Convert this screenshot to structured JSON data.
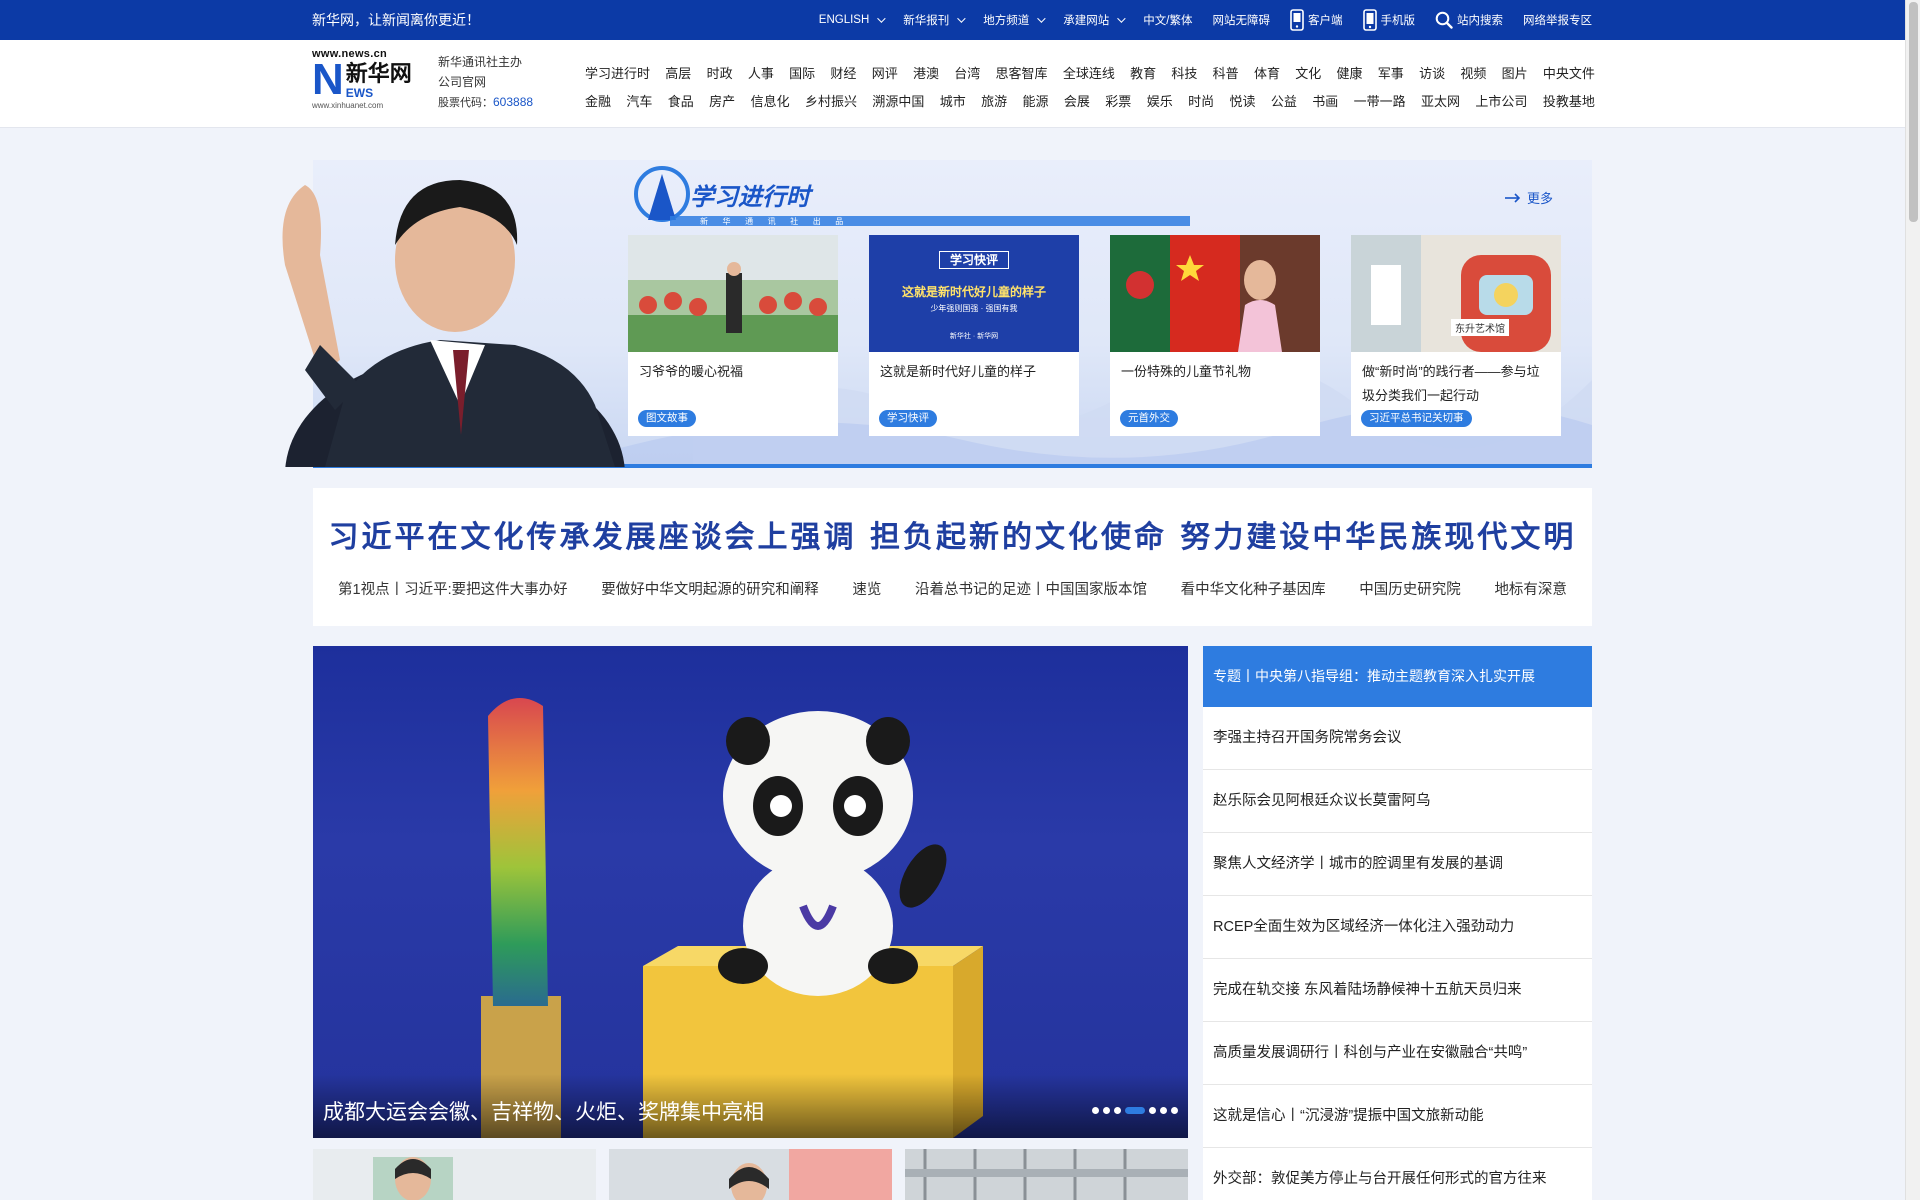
{
  "topbar": {
    "slogan": "新华网，让新闻离你更近！",
    "items": [
      {
        "label": "ENGLISH",
        "dropdown": true
      },
      {
        "label": "新华报刊",
        "dropdown": true
      },
      {
        "label": "地方频道",
        "dropdown": true
      },
      {
        "label": "承建网站",
        "dropdown": true
      },
      {
        "label": "中文/繁体",
        "dropdown": false
      },
      {
        "label": "网站无障碍",
        "dropdown": false
      },
      {
        "label": "客户端",
        "icon": "phone-app-icon"
      },
      {
        "label": "手机版",
        "icon": "mobile-icon"
      },
      {
        "label": "站内搜索",
        "icon": "search-icon"
      },
      {
        "label": "网络举报专区",
        "dropdown": false
      }
    ]
  },
  "header": {
    "logo": {
      "domain": "www.news.cn",
      "n": "N",
      "ews": "EWS",
      "cn": "新华网",
      "sub": "www.xinhuanet.com"
    },
    "corp_line1": "新华通讯社主办",
    "corp_line2": "公司官网",
    "stock_label": "股票代码：",
    "stock_code": "603888",
    "nav_row1": [
      "学习进行时",
      "高层",
      "时政",
      "人事",
      "国际",
      "财经",
      "网评",
      "港澳",
      "台湾",
      "思客智库",
      "全球连线",
      "教育",
      "科技",
      "科普",
      "体育",
      "文化",
      "健康",
      "军事",
      "访谈",
      "视频",
      "图片",
      "中央文件"
    ],
    "nav_row2": [
      "金融",
      "汽车",
      "食品",
      "房产",
      "信息化",
      "乡村振兴",
      "溯源中国",
      "城市",
      "旅游",
      "能源",
      "会展",
      "彩票",
      "娱乐",
      "时尚",
      "悦读",
      "公益",
      "书画",
      "一带一路",
      "亚太网",
      "上市公司",
      "投教基地"
    ]
  },
  "banner": {
    "title": "学习进行时",
    "subtitle": "新 华 通 讯 社 出 品",
    "more": "更多",
    "cards": [
      {
        "title": "习爷爷的暖心祝福",
        "tag": "图文故事"
      },
      {
        "title": "这就是新时代好儿童的样子",
        "tag": "学习快评",
        "thumb_title": "学习快评",
        "thumb_text": "这就是新时代好儿童的样子",
        "thumb_sub": "少年强则国强 · 强国有我",
        "thumb_source": "新华社 · 新华网"
      },
      {
        "title": "一份特殊的儿童节礼物",
        "tag": "元首外交"
      },
      {
        "title": "做“新时尚”的践行者——参与垃圾分类我们一起行动",
        "tag": "习近平总书记关切事",
        "thumb_label": "东升艺术馆"
      }
    ]
  },
  "headline": {
    "title": "习近平在文化传承发展座谈会上强调 担负起新的文化使命 努力建设中华民族现代文明",
    "links": [
      "第1视点丨习近平:要把这件大事办好",
      "要做好中华文明起源的研究和阐释",
      "速览",
      "沿着总书记的足迹丨中国国家版本馆",
      "看中华文化种子基因库",
      "中国历史研究院",
      "地标有深意"
    ]
  },
  "slider": {
    "caption": "成都大运会会徽、吉祥物、火炬、奖牌集中亮相",
    "dots": 7,
    "active_dot": 4
  },
  "newslist": {
    "featured": "专题丨中央第八指导组：推动主题教育深入扎实开展",
    "items": [
      "李强主持召开国务院常务会议",
      "赵乐际会见阿根廷众议长莫雷阿乌",
      "聚焦人文经济学丨城市的腔调里有发展的基调",
      "RCEP全面生效为区域经济一体化注入强劲动力",
      "完成在轨交接 东风着陆场静候神十五航天员归来",
      "高质量发展调研行丨科创与产业在安徽融合“共鸣”",
      "这就是信心丨“沉浸游”提振中国文旅新动能",
      "外交部：敦促美方停止与台开展任何形式的官方往来"
    ]
  },
  "colors": {
    "brand_blue": "#0c3aa6",
    "accent": "#2e7ce0",
    "headline": "#1f3fa0"
  }
}
